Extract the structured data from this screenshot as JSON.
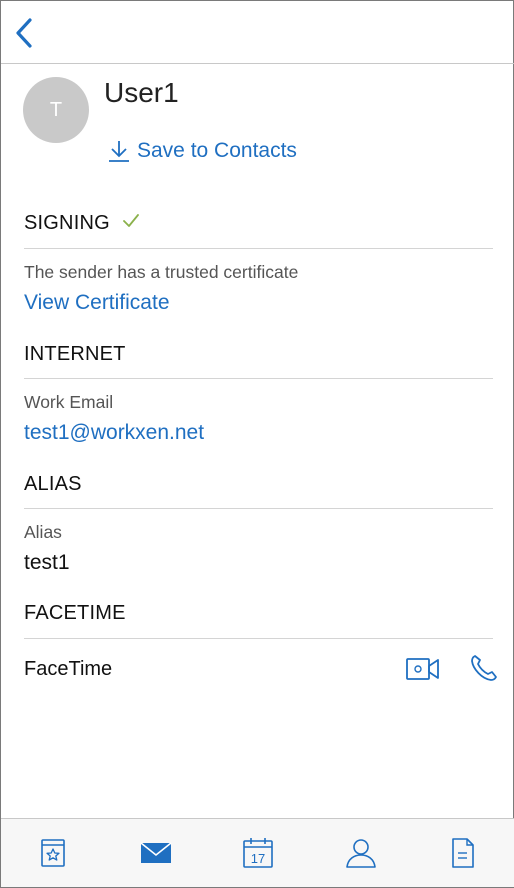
{
  "colors": {
    "accent": "#1f6fc1",
    "check": "#8bb14b",
    "avatar_bg": "#c9c9c9"
  },
  "nav": {
    "back_icon": "chevron-left-icon"
  },
  "contact": {
    "initial": "T",
    "name": "User1",
    "save_label": "Save to Contacts"
  },
  "signing": {
    "header": "SIGNING",
    "status_icon": "checkmark-icon",
    "description": "The sender has a trusted certificate",
    "view_link": "View Certificate"
  },
  "internet": {
    "header": "INTERNET",
    "label": "Work Email",
    "email": "test1@workxen.net"
  },
  "alias": {
    "header": "ALIAS",
    "label": "Alias",
    "value": "test1"
  },
  "facetime": {
    "header": "FACETIME",
    "label": "FaceTime",
    "video_icon": "video-camera-icon",
    "audio_icon": "phone-icon"
  },
  "tabbar": {
    "items": [
      {
        "icon": "favorites-icon"
      },
      {
        "icon": "mail-icon",
        "active": true
      },
      {
        "icon": "calendar-icon",
        "day": "17"
      },
      {
        "icon": "contacts-icon"
      },
      {
        "icon": "files-icon"
      }
    ]
  }
}
